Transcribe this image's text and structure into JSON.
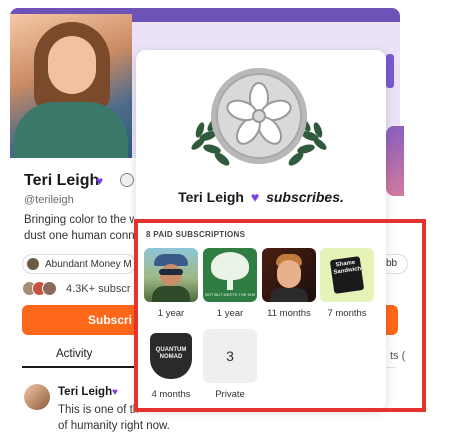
{
  "profile": {
    "name": "Teri Leigh",
    "handle": "@terileigh",
    "bio_line1": "Bringing color to the w",
    "bio_line2": "dust one human conn",
    "publication_chip": "Abundant Money M",
    "publication_chip_right": "bb",
    "subscribers": "4.3K+ subscr",
    "subscribe_button": "Subscri",
    "tabs": {
      "activity": "Activity",
      "right_partial": "ts ("
    }
  },
  "post": {
    "author": "Teri Leigh",
    "line1": "This is one of th",
    "line2": "of humanity right now."
  },
  "popover": {
    "name": "Teri Leigh",
    "action": "subscribes.",
    "paid_label": "8 PAID SUBSCRIPTIONS",
    "subscriptions": [
      {
        "id": "s1",
        "caption": "1 year"
      },
      {
        "id": "s2",
        "caption": "1 year",
        "tile_text": "NOT BUT MEETS THE SHADOW"
      },
      {
        "id": "s3",
        "caption": "11 months"
      },
      {
        "id": "s4",
        "caption": "7 months",
        "tile_text": "Shame Sandwich"
      },
      {
        "id": "s5",
        "caption": "4 months",
        "tile_text": "QUANTUM NOMAD"
      },
      {
        "id": "s6",
        "caption": "Private",
        "tile_text": "3"
      }
    ]
  },
  "icons": {
    "heart": "♥",
    "badge": "award-icon",
    "medal": "flower-medal-icon"
  },
  "colors": {
    "brand_orange": "#ff6719",
    "banner_purple": "#6d52b8",
    "heart_purple": "#7b3fe4",
    "highlight_red": "#e5322d"
  }
}
